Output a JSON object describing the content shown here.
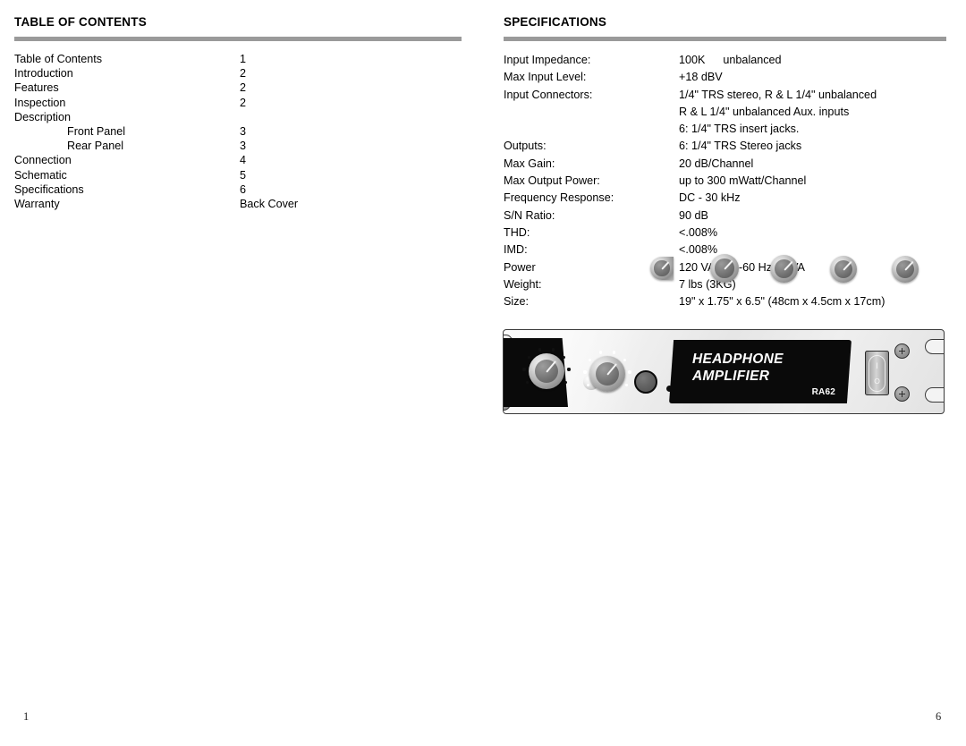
{
  "document": {
    "page_number_left": "1",
    "page_number_right": "6",
    "rule_color": "#9a9a9a"
  },
  "toc": {
    "title": "TABLE OF CONTENTS",
    "entries": [
      {
        "label": "Table of Contents",
        "page": "1",
        "indent": false
      },
      {
        "label": "Introduction",
        "page": "2",
        "indent": false
      },
      {
        "label": "Features",
        "page": "2",
        "indent": false
      },
      {
        "label": "Inspection",
        "page": "2",
        "indent": false
      },
      {
        "label": "Description",
        "page": "",
        "indent": false
      },
      {
        "label": "Front Panel",
        "page": "3",
        "indent": true
      },
      {
        "label": "Rear Panel",
        "page": "3",
        "indent": true
      },
      {
        "label": "Connection",
        "page": "4",
        "indent": false
      },
      {
        "label": "Schematic",
        "page": "5",
        "indent": false
      },
      {
        "label": "Specifications",
        "page": "6",
        "indent": false
      },
      {
        "label": "Warranty",
        "page": "Back Cover",
        "indent": false
      }
    ]
  },
  "specifications": {
    "title": "SPECIFICATIONS",
    "rows": [
      {
        "label": "Input Impedance:",
        "value": "100K",
        "value2": "unbalanced"
      },
      {
        "label": "Max Input Level:",
        "value": "+18 dBV"
      },
      {
        "label": "Input Connectors:",
        "value": "1/4\" TRS stereo, R & L 1/4\" unbalanced"
      },
      {
        "label": "",
        "value": "R & L 1/4\" unbalanced Aux. inputs"
      },
      {
        "label": "",
        "value": "6: 1/4\" TRS insert jacks."
      },
      {
        "label": "Outputs:",
        "value": "6: 1/4\" TRS Stereo jacks"
      },
      {
        "label": "Max Gain:",
        "value": "20 dB/Channel"
      },
      {
        "label": "Max Output Power:",
        "value": "up to 300 mWatt/Channel"
      },
      {
        "label": "Frequency Response:",
        "value": "DC - 30 kHz"
      },
      {
        "label": "S/N Ratio:",
        "value": "90 dB"
      },
      {
        "label": "THD:",
        "value": "<.008%"
      },
      {
        "label": "IMD:",
        "value": "<.008%"
      },
      {
        "label": "Power",
        "value": "120 VAC 50-60 Hz 20 VA"
      },
      {
        "label": "Weight:",
        "value": "7 lbs (3KG)"
      },
      {
        "label": "Size:",
        "value": "19\" x 1.75\" x 6.5\" (48cm x 4.5cm x 17cm)"
      }
    ]
  },
  "product_panel": {
    "legend_line1": "HEADPHONE",
    "legend_line2": "AMPLIFIER",
    "model": "RA62",
    "power_switch_on": "I",
    "power_switch_off": "O"
  }
}
